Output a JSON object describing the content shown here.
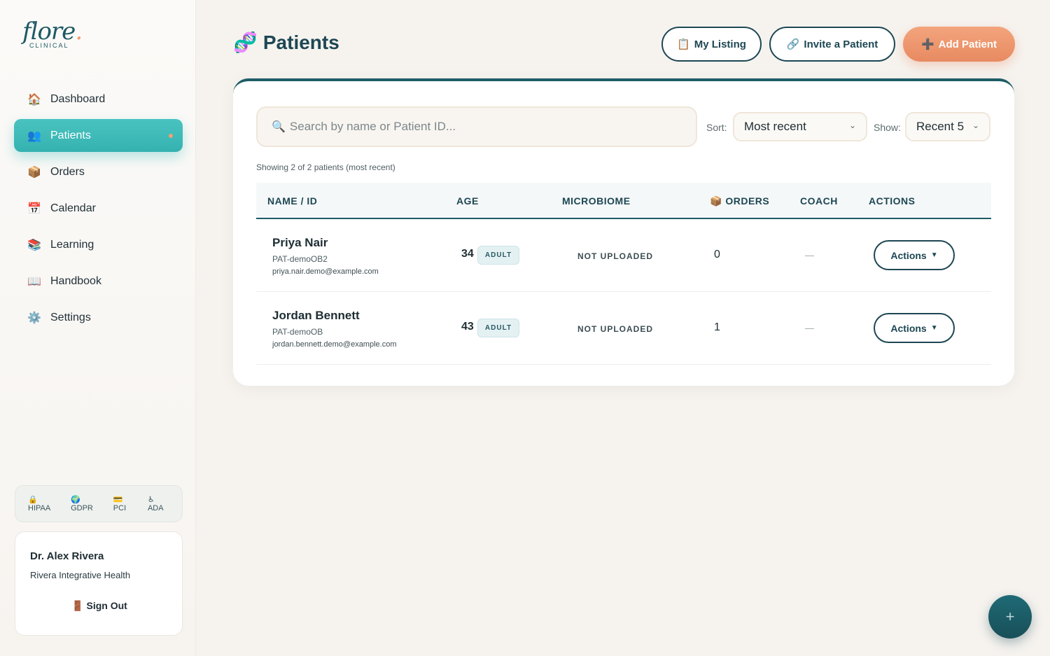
{
  "brand": {
    "name": "flore",
    "dot": ".",
    "sub": "CLINICAL"
  },
  "sidebar": {
    "items": [
      {
        "label": "Dashboard",
        "icon": "🏠"
      },
      {
        "label": "Patients",
        "icon": "👥"
      },
      {
        "label": "Orders",
        "icon": "📦"
      },
      {
        "label": "Calendar",
        "icon": "📅"
      },
      {
        "label": "Learning",
        "icon": "📚"
      },
      {
        "label": "Handbook",
        "icon": "📖"
      },
      {
        "label": "Settings",
        "icon": "⚙️"
      }
    ],
    "compliance": [
      {
        "icon": "🔒",
        "label": "HIPAA"
      },
      {
        "icon": "🌍",
        "label": "GDPR"
      },
      {
        "icon": "💳",
        "label": "PCI"
      },
      {
        "icon": "♿",
        "label": "ADA"
      }
    ],
    "user": {
      "name": "Dr. Alex Rivera",
      "org": "Rivera Integrative Health",
      "signout_icon": "🚪",
      "signout": "Sign Out"
    }
  },
  "header": {
    "title_icon": "🧬",
    "title": "Patients",
    "my_listing": {
      "icon": "📋",
      "label": "My Listing"
    },
    "invite": {
      "icon": "🔗",
      "label": "Invite a Patient"
    },
    "add": {
      "icon": "➕",
      "label": "Add Patient"
    }
  },
  "filters": {
    "search_icon": "🔍",
    "search_placeholder": "Search by name or Patient ID...",
    "sort_label": "Sort:",
    "sort_value": "Most recent",
    "show_label": "Show:",
    "show_value": "Recent 5",
    "chevron": "⌄"
  },
  "showing": "Showing 2 of 2 patients (most recent)",
  "table": {
    "columns": {
      "name": "NAME / ID",
      "age": "AGE",
      "microbiome": "MICROBIOME",
      "orders_icon": "📦",
      "orders": "ORDERS",
      "coach": "COACH",
      "actions": "ACTIONS"
    },
    "rows": [
      {
        "name": "Priya Nair",
        "id": "PAT-demoOB2",
        "email": "priya.nair.demo@example.com",
        "age": "34",
        "age_badge": "ADULT",
        "microbiome": "NOT UPLOADED",
        "orders": "0",
        "coach": "—",
        "action": "Actions",
        "caret": "▼"
      },
      {
        "name": "Jordan Bennett",
        "id": "PAT-demoOB",
        "email": "jordan.bennett.demo@example.com",
        "age": "43",
        "age_badge": "ADULT",
        "microbiome": "NOT UPLOADED",
        "orders": "1",
        "coach": "—",
        "action": "Actions",
        "caret": "▼"
      }
    ]
  },
  "fab": {
    "icon": "+"
  }
}
